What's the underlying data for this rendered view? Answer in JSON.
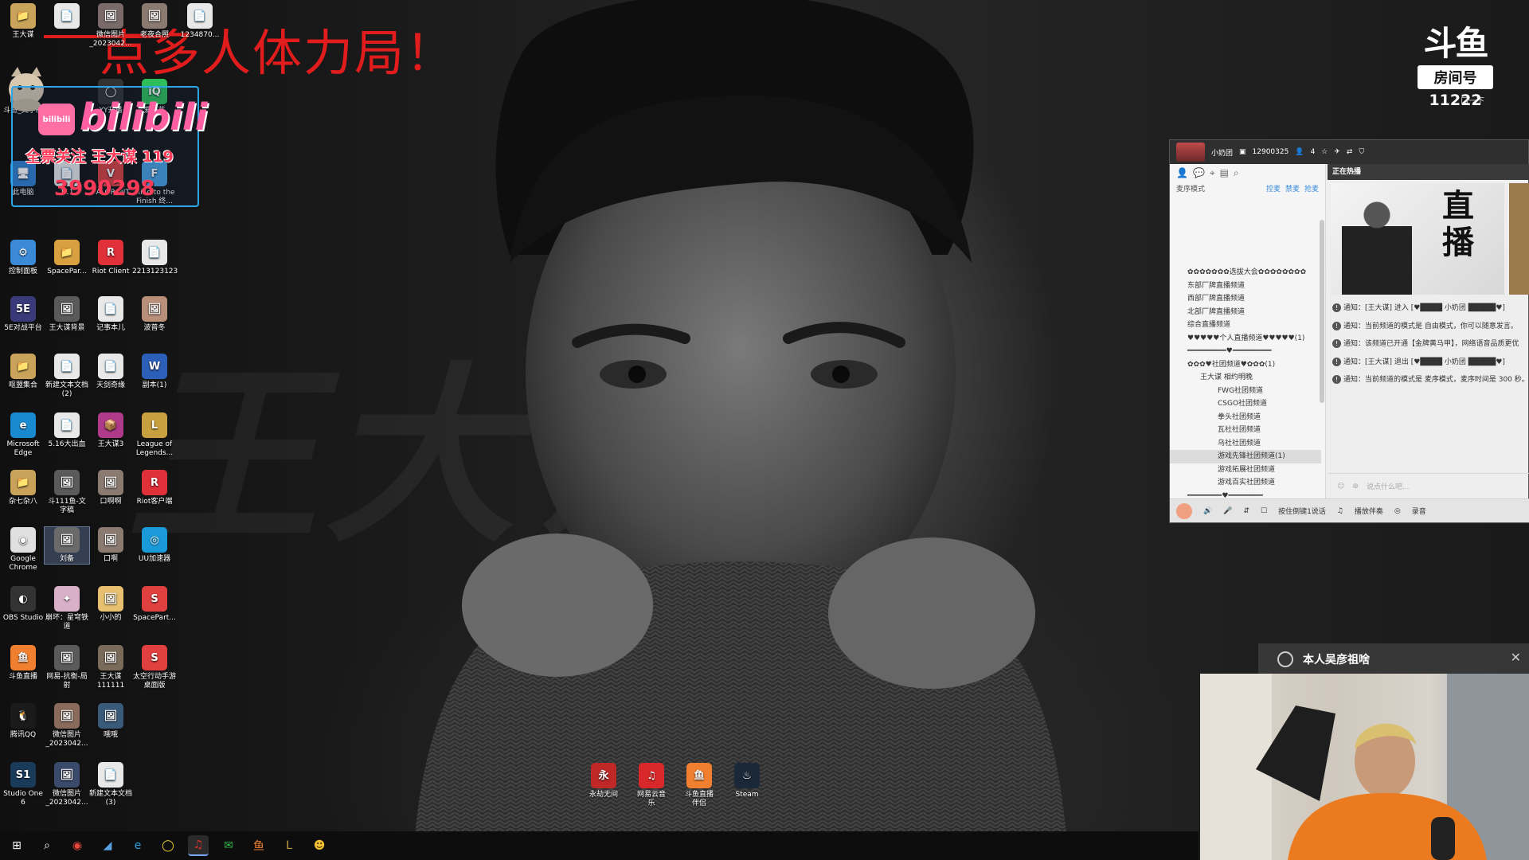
{
  "overlay_title": "点多人体力局！",
  "bili": {
    "tv_label": "bilibili",
    "logo": "bilibili",
    "follow_text": "全票关注 王大谋 119",
    "number": "3990298"
  },
  "desktop_icons": [
    {
      "label": "王大谋",
      "color": "#c9a35a",
      "glyph": "📁"
    },
    {
      "label": "",
      "color": "#e8e8e8",
      "glyph": "📄"
    },
    {
      "label": "微信图片_2023042...",
      "color": "#7a6a6a",
      "glyph": "🖼"
    },
    {
      "label": "老夜合照",
      "color": "#8a7a70",
      "glyph": "🖼"
    },
    {
      "label": "1234870...",
      "color": "#e8e8e8",
      "glyph": "📄"
    },
    {
      "label": "斗鱼_文字稿",
      "color": "#b0a8a0",
      "glyph": "🐱"
    },
    {
      "label": "YY开播",
      "color": "#333",
      "glyph": "◯"
    },
    {
      "label": "爱奇艺",
      "color": "#2fbf5a",
      "glyph": "iQ"
    },
    {
      "label": "此电脑",
      "color": "#2f7fd0",
      "glyph": "🖥"
    },
    {
      "label": "111",
      "color": "#e8e8e8",
      "glyph": "📄"
    },
    {
      "label": "VALORANT",
      "color": "#d8413f",
      "glyph": "V"
    },
    {
      "label": "Fling to the Finish 终...",
      "color": "#4aa0e0",
      "glyph": "F"
    },
    {
      "label": "控制面板",
      "color": "#3a8ad8",
      "glyph": "⚙"
    },
    {
      "label": "SpacePar...",
      "color": "#d8a040",
      "glyph": "📁"
    },
    {
      "label": "Riot Client",
      "color": "#e0303a",
      "glyph": "R"
    },
    {
      "label": "2213123123",
      "color": "#e8e8e8",
      "glyph": "📄"
    },
    {
      "label": "5E对战平台",
      "color": "#3a3a7a",
      "glyph": "5E"
    },
    {
      "label": "王大谋背景",
      "color": "#5a5a5a",
      "glyph": "🖼"
    },
    {
      "label": "记事本儿",
      "color": "#e8e8e8",
      "glyph": "📄"
    },
    {
      "label": "波普冬",
      "color": "#b8907a",
      "glyph": "🖼"
    },
    {
      "label": "呕盟集合",
      "color": "#c9a35a",
      "glyph": "📁"
    },
    {
      "label": "新建文本文档 (2)",
      "color": "#e8e8e8",
      "glyph": "📄"
    },
    {
      "label": "天剑奇缘",
      "color": "#e8e8e8",
      "glyph": "📄"
    },
    {
      "label": "副本(1)",
      "color": "#2b5fb8",
      "glyph": "W"
    },
    {
      "label": "Microsoft Edge",
      "color": "#1a8ad0",
      "glyph": "e"
    },
    {
      "label": "5.16大出血",
      "color": "#e8e8e8",
      "glyph": "📄"
    },
    {
      "label": "王大谋3",
      "color": "#b03a8a",
      "glyph": "📦"
    },
    {
      "label": "League of Legends...",
      "color": "#c8a040",
      "glyph": "L"
    },
    {
      "label": "杂七杂八",
      "color": "#c9a35a",
      "glyph": "📁"
    },
    {
      "label": "斗111鱼-文字稿",
      "color": "#5a5a5a",
      "glyph": "🖼"
    },
    {
      "label": "口啊啊",
      "color": "#8a7a70",
      "glyph": "🖼"
    },
    {
      "label": "Riot客户端",
      "color": "#e0303a",
      "glyph": "R"
    },
    {
      "label": "Google Chrome",
      "color": "#e0e0e0",
      "glyph": "◉"
    },
    {
      "label": "刘备",
      "color": "#6a6a6a",
      "glyph": "🖼"
    },
    {
      "label": "口啊",
      "color": "#8a7a70",
      "glyph": "🖼"
    },
    {
      "label": "UU加速器",
      "color": "#1a9ad8",
      "glyph": "◎"
    },
    {
      "label": "OBS Studio",
      "color": "#333",
      "glyph": "◐"
    },
    {
      "label": "崩坏：星穹铁道",
      "color": "#d8b0c8",
      "glyph": "✦"
    },
    {
      "label": "小小的",
      "color": "#e8c070",
      "glyph": "🖼"
    },
    {
      "label": "SpacePart...",
      "color": "#e04040",
      "glyph": "S"
    },
    {
      "label": "斗鱼直播",
      "color": "#f08030",
      "glyph": "鱼"
    },
    {
      "label": "网易-抗衡-局射",
      "color": "#5a5a5a",
      "glyph": "🖼"
    },
    {
      "label": "王大谋111111",
      "color": "#7a6a5a",
      "glyph": "🖼"
    },
    {
      "label": "太空行动手游桌面版",
      "color": "#e04040",
      "glyph": "S"
    },
    {
      "label": "腾讯QQ",
      "color": "#1a1a1a",
      "glyph": "🐧"
    },
    {
      "label": "微信图片_2023042...",
      "color": "#8a6a5a",
      "glyph": "🖼"
    },
    {
      "label": "哦哦",
      "color": "#3a5a7a",
      "glyph": "🖼"
    },
    {
      "label": "Studio One 6",
      "color": "#1a3a5a",
      "glyph": "S1"
    },
    {
      "label": "微信图片_2023042...",
      "color": "#3a4a6a",
      "glyph": "🖼"
    },
    {
      "label": "新建文本文档 (3)",
      "color": "#e8e8e8",
      "glyph": "📄"
    }
  ],
  "dock_icons": [
    {
      "label": "永劫无间",
      "color": "#c02828",
      "glyph": "永"
    },
    {
      "label": "网易云音乐",
      "color": "#d8282a",
      "glyph": "♫"
    },
    {
      "label": "斗鱼直播伴侣",
      "color": "#f08030",
      "glyph": "鱼"
    },
    {
      "label": "Steam",
      "color": "#1b2838",
      "glyph": "♨"
    }
  ],
  "douyu": {
    "logo": "斗鱼",
    "room_label": "房间号",
    "room_id": "11222",
    "small_label": "口一下"
  },
  "yy": {
    "title": "小奶团",
    "id": "12900325",
    "online": "4",
    "mode": "麦序模式",
    "links": [
      "控麦",
      "禁麦",
      "抢麦"
    ],
    "hot_title": "正在热播",
    "hot_caption": "直播",
    "tree": [
      {
        "text": "✿✿✿✿✿✿✿选拔大会✿✿✿✿✿✿✿✿",
        "cls": ""
      },
      {
        "text": "东部厂牌直播频道",
        "cls": ""
      },
      {
        "text": "西部厂牌直播频道",
        "cls": ""
      },
      {
        "text": "北部厂牌直播频道",
        "cls": ""
      },
      {
        "text": "综合直播频道",
        "cls": ""
      },
      {
        "text": "♥♥♥♥♥个人直播频道♥♥♥♥♥(1)",
        "cls": ""
      },
      {
        "text": "━━━━━━━━━♥━━━━━━━━━",
        "cls": ""
      },
      {
        "text": "✿✿✿♥社团频道♥✿✿✿(1)",
        "cls": ""
      },
      {
        "text": "王大谋  相约明晚",
        "cls": "user"
      },
      {
        "text": "FWG社团频道",
        "cls": "sub"
      },
      {
        "text": "CSGO社团频道",
        "cls": "sub"
      },
      {
        "text": "拳头社团频道",
        "cls": "sub"
      },
      {
        "text": "瓦社社团频道",
        "cls": "sub"
      },
      {
        "text": "乌社社团频道",
        "cls": "sub"
      },
      {
        "text": "游戏先锋社团频道(1)",
        "cls": "sub hl"
      },
      {
        "text": "游戏拓展社团频道",
        "cls": "sub"
      },
      {
        "text": "游戏百实社团频道",
        "cls": "sub"
      },
      {
        "text": "━━━━━━━━♥━━━━━━━━",
        "cls": ""
      }
    ],
    "messages": [
      "通知：[王大谋] 进入 [♥████ 小奶团 █████♥]",
      "通知：当前频道的模式是 自由模式，你可以随意发言。",
      "通知：该频道已开通【金牌黄马甲】，网络语音品质更优",
      "通知：[王大谋] 退出 [♥████ 小奶团 █████♥]",
      "通知：当前频道的模式是 麦序模式，麦序时间是 300 秒。"
    ],
    "input_placeholder": "说点什么吧...",
    "bottom": [
      "按住倒键1说话",
      "播放伴奏",
      "录音"
    ]
  },
  "cam_bar": {
    "text": "本人吴彦祖啥"
  }
}
